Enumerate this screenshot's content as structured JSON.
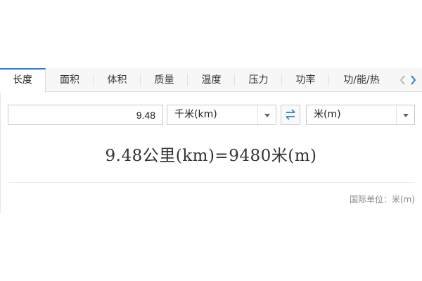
{
  "tabs": [
    {
      "label": "长度",
      "active": true
    },
    {
      "label": "面积",
      "active": false
    },
    {
      "label": "体积",
      "active": false
    },
    {
      "label": "质量",
      "active": false
    },
    {
      "label": "温度",
      "active": false
    },
    {
      "label": "压力",
      "active": false
    },
    {
      "label": "功率",
      "active": false
    },
    {
      "label": "功/能/热",
      "active": false
    }
  ],
  "input": {
    "value": "9.48"
  },
  "from_unit": {
    "selected": "千米(km)"
  },
  "to_unit": {
    "selected": "米(m)"
  },
  "icons": {
    "swap": "swap-arrows-icon",
    "prev": "chevron-left-icon",
    "next": "chevron-right-icon",
    "dropdown": "caret-down-icon"
  },
  "result": {
    "text": "9.48公里(km)=9480米(m)"
  },
  "footer": {
    "unit_label": "国际单位：米(m)"
  },
  "colors": {
    "accent": "#2f7fd8",
    "tab_bar_bg": "#f7f7f7",
    "border": "#c9c9c9",
    "muted_text": "#888888"
  }
}
